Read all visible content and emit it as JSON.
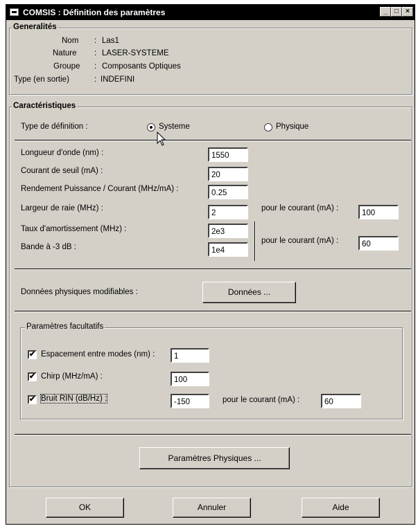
{
  "window": {
    "title": "COMSIS : Définition des paramètres",
    "controls": {
      "minimize": "_",
      "maximize": "□",
      "close": "×"
    }
  },
  "generalites": {
    "title": "Generalités",
    "rows": [
      {
        "label": "Nom",
        "value": "Las1"
      },
      {
        "label": "Nature",
        "value": "LASER-SYSTEME"
      },
      {
        "label": "Groupe",
        "value": "Composants Optiques"
      },
      {
        "label": "Type (en sortie)",
        "value": "INDEFINI"
      }
    ],
    "separator": ":"
  },
  "caracteristiques": {
    "title": "Caractéristiques",
    "type_definition_label": "Type de définition :",
    "radio_systeme": "Systeme",
    "radio_physique": "Physique",
    "selected": "Systeme",
    "fields": {
      "longueur_label": "Longueur d'onde (nm) :",
      "longueur_value": "1550",
      "courant_seuil_label": "Courant de seuil (mA) :",
      "courant_seuil_value": "20",
      "rendement_label": "Rendement Puissance / Courant (MHz/mA) :",
      "rendement_value": "0.25",
      "largeur_label": "Largeur de raie (MHz) :",
      "largeur_value": "2",
      "largeur_courant_label": "pour le courant (mA) :",
      "largeur_courant_value": "100",
      "taux_label": "Taux d'amortissement (MHz) :",
      "taux_value": "2e3",
      "bande_label": "Bande à -3 dB :",
      "bande_value": "1e4",
      "taux_courant_label": "pour le courant (mA) :",
      "taux_courant_value": "60"
    },
    "donnees_label": "Données physiques modifiables :",
    "donnees_button": "Données ..."
  },
  "facultatifs": {
    "title": "Paramètres facultatifs",
    "espacement_label": "Espacement entre modes (nm) :",
    "espacement_value": "1",
    "espacement_checked": true,
    "chirp_label": "Chirp (MHz/mA) :",
    "chirp_value": "100",
    "chirp_checked": true,
    "bruit_label": "Bruit RIN (dB/Hz) :",
    "bruit_value": "-150",
    "bruit_checked": true,
    "bruit_courant_label": "pour le courant (mA) :",
    "bruit_courant_value": "60",
    "check_glyph": "✔"
  },
  "buttons": {
    "parametres_physiques": "Paramètres Physiques ...",
    "ok": "OK",
    "annuler": "Annuler",
    "aide": "Aide"
  }
}
